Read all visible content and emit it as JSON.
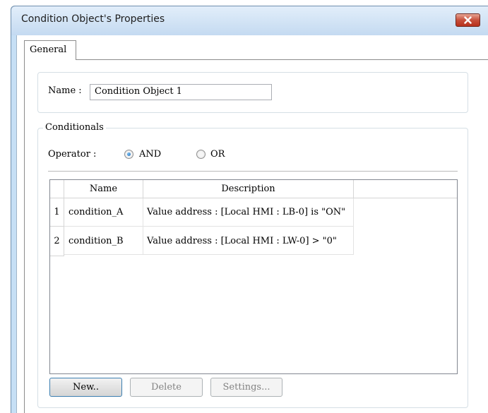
{
  "window": {
    "title": "Condition Object's Properties"
  },
  "tabs": [
    {
      "label": "General",
      "active": true
    }
  ],
  "name_field": {
    "label": "Name :",
    "value": "Condition Object 1"
  },
  "conditionals": {
    "caption": "Conditionals",
    "operator": {
      "label": "Operator :",
      "options": [
        {
          "label": "AND",
          "selected": true
        },
        {
          "label": "OR",
          "selected": false
        }
      ]
    },
    "table": {
      "columns": [
        "Name",
        "Description"
      ],
      "rows": [
        {
          "index": "1",
          "name": "condition_A",
          "description": "Value address : [Local HMI : LB-0] is \"ON\""
        },
        {
          "index": "2",
          "name": "condition_B",
          "description": "Value address : [Local HMI : LW-0] > \"0\""
        }
      ]
    }
  },
  "buttons": {
    "new": "New..",
    "delete": "Delete",
    "settings": "Settings..."
  },
  "colors": {
    "titlebar": "#c4daf1",
    "close_button": "#c7503c",
    "focus_border": "#3c7fb1"
  }
}
